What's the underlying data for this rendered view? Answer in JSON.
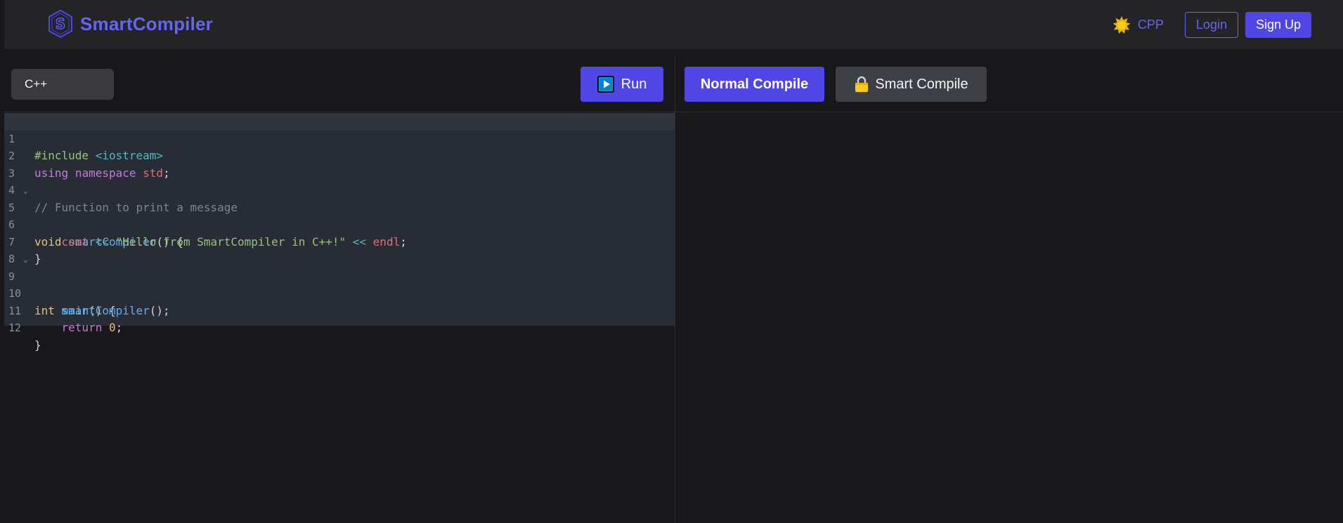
{
  "header": {
    "brand_name": "SmartCompiler",
    "language_link": "CPP",
    "login_label": "Login",
    "signup_label": "Sign Up"
  },
  "editor": {
    "language_selected": "C++",
    "run_label": "Run",
    "line_numbers": [
      "1",
      "2",
      "3",
      "4",
      "5",
      "6",
      "7",
      "8",
      "9",
      "10",
      "11",
      "12"
    ],
    "code": {
      "include": "#include",
      "header": "<iostream>",
      "using": "using",
      "namespace": "namespace",
      "std": "std",
      "semi": ";",
      "comment": "// Function to print a message",
      "void": "void",
      "fn_name": "smartCompiler",
      "parens_brace": "() {",
      "cout": "cout",
      "op": "<<",
      "string": "\"Hello from SmartCompiler in C++!\"",
      "endl": "endl",
      "close_brace": "}",
      "int": "int",
      "main": "main",
      "call_tail": "();",
      "return": "return",
      "zero": "0"
    }
  },
  "output": {
    "normal_compile_label": "Normal Compile",
    "smart_compile_label": "Smart Compile"
  },
  "colors": {
    "accent": "#4f46e5",
    "brand": "#6366f1",
    "background": "#18181b",
    "header_bg": "#242427",
    "editor_bg": "#282c34"
  }
}
